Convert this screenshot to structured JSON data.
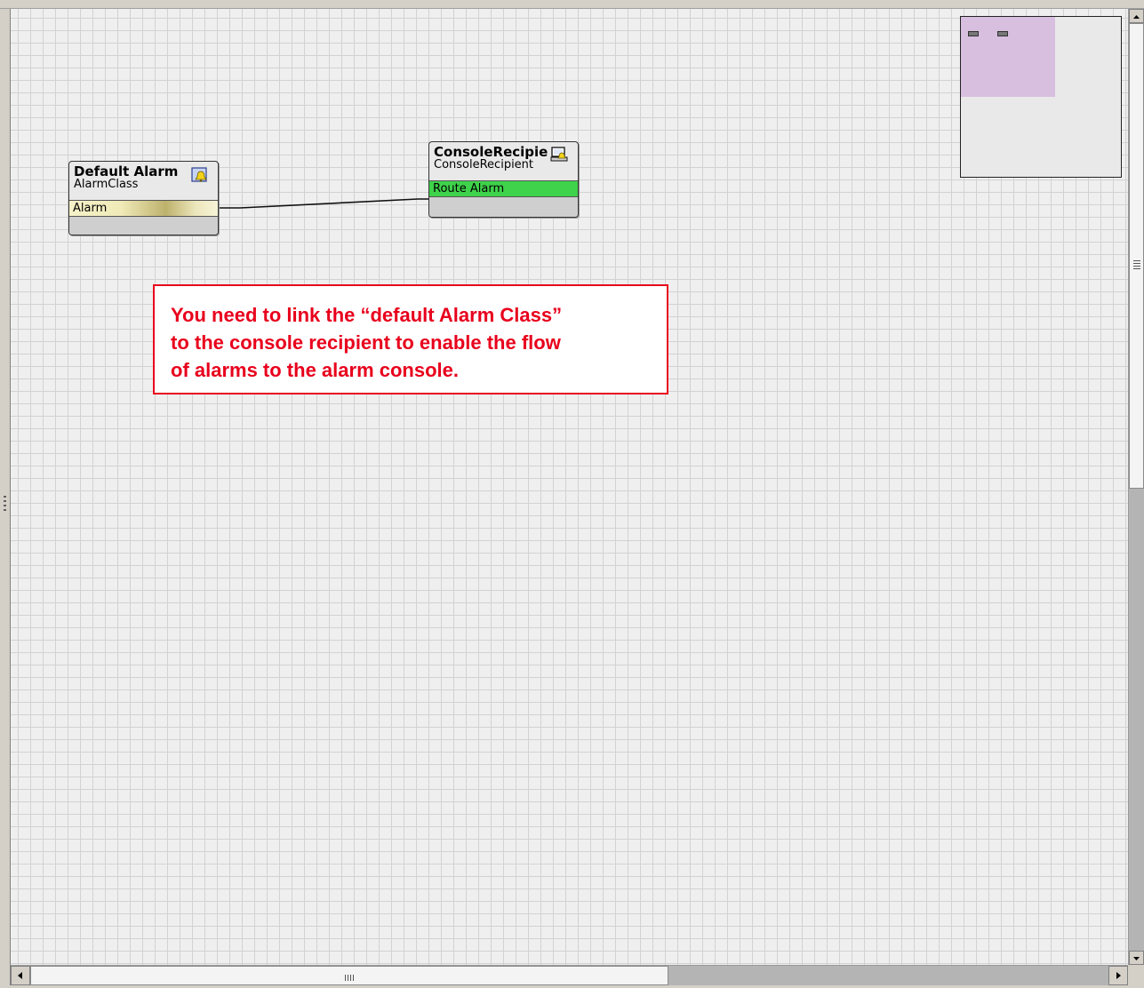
{
  "wiresheet": {
    "nodes": [
      {
        "title": "Default Alarm",
        "type": "AlarmClass",
        "slot": "Alarm",
        "icon": "alarm-class-icon"
      },
      {
        "title": "ConsoleRecipie",
        "type": "ConsoleRecipient",
        "slot": "Route Alarm",
        "icon": "console-recipient-icon"
      }
    ],
    "link": {
      "from": "Default Alarm.Alarm",
      "to": "ConsoleRecipie.Route Alarm"
    }
  },
  "annotation": {
    "lines": [
      "You need to link the “default Alarm Class”",
      "to the console recipient to enable the flow",
      "of alarms to the alarm console."
    ],
    "color": "#e8001c"
  },
  "colors": {
    "grid_bg": "#efefef",
    "alarm_slot_gold": "#bdb16c",
    "route_slot_green": "#3fd24b",
    "minimap_view": "#d8bfe0"
  }
}
